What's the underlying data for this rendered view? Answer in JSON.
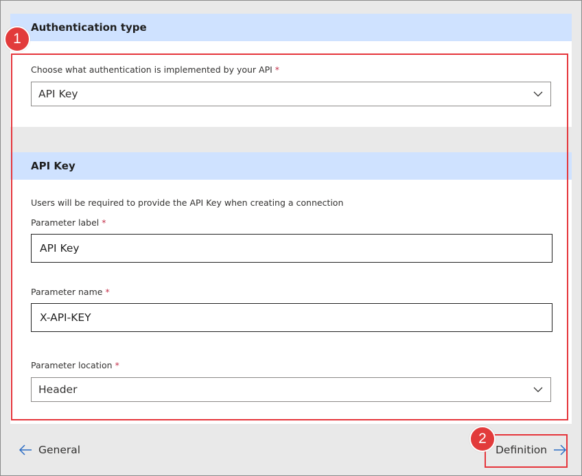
{
  "auth_section": {
    "title": "Authentication type",
    "field_label": "Choose what authentication is implemented by your API",
    "required_mark": "*",
    "selected": "API Key"
  },
  "key_section": {
    "title": "API Key",
    "help_text": "Users will be required to provide the API Key when creating a connection",
    "param_label": {
      "label": "Parameter label",
      "required_mark": "*",
      "value": "API Key"
    },
    "param_name": {
      "label": "Parameter name",
      "required_mark": "*",
      "value": "X-API-KEY"
    },
    "param_location": {
      "label": "Parameter location",
      "required_mark": "*",
      "selected": "Header"
    }
  },
  "navigation": {
    "back_label": "General",
    "next_label": "Definition"
  },
  "callouts": {
    "one": "1",
    "two": "2"
  },
  "colors": {
    "section_header": "#cfe2ff",
    "highlight": "#e5343a",
    "arrow": "#2b6cc4",
    "required": "#c4314b"
  },
  "icons": {
    "dropdown": "chevron-down-icon",
    "back": "arrow-left-icon",
    "next": "arrow-right-icon"
  }
}
